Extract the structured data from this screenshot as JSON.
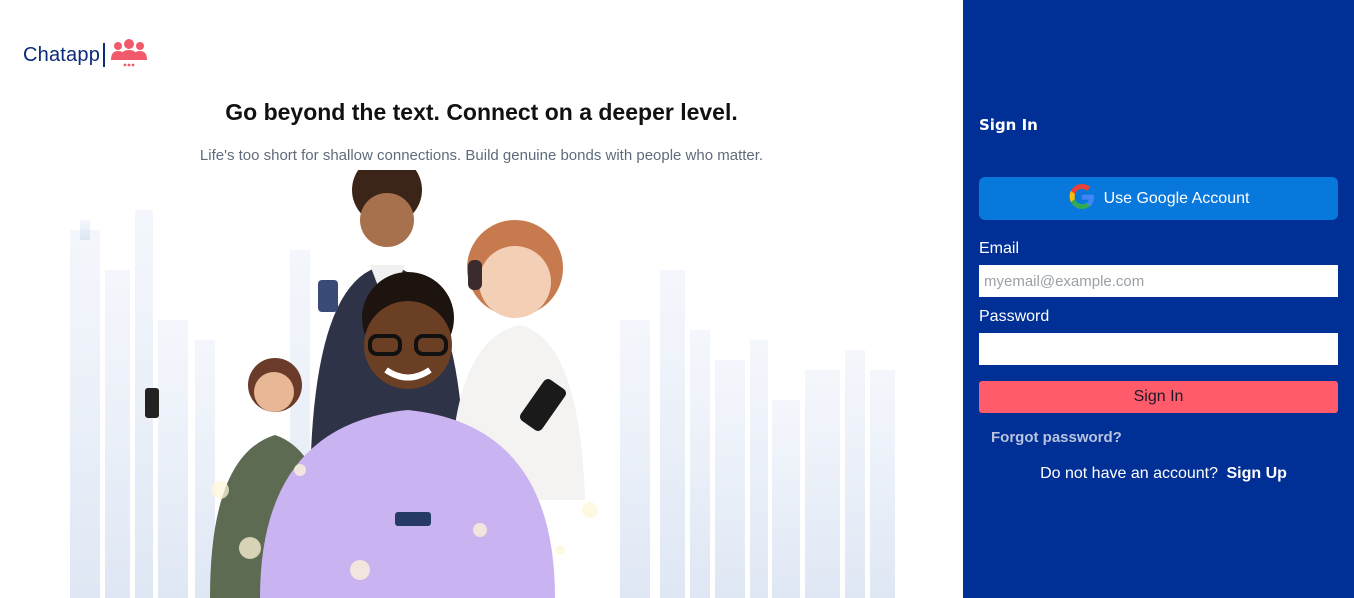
{
  "brand": {
    "name": "Chatapp",
    "icon": "people-group-icon",
    "color": "#0a2a7a",
    "icon_color": "#f25a6b"
  },
  "hero": {
    "headline": "Go beyond the text. Connect on a deeper level.",
    "subtext": "Life's too short for shallow connections. Build genuine bonds with people who matter."
  },
  "signin": {
    "title": "Sign In",
    "google_button": "Use Google Account",
    "email_label": "Email",
    "email_placeholder": "myemail@example.com",
    "email_value": "",
    "password_label": "Password",
    "password_value": "",
    "submit_label": "Sign In",
    "forgot_link": "Forgot password?",
    "signup_prompt": "Do not have an account?",
    "signup_link": "Sign Up"
  },
  "colors": {
    "panel_bg": "#002f95",
    "google_btn": "#0878dc",
    "submit_btn": "#ff5b6b"
  }
}
